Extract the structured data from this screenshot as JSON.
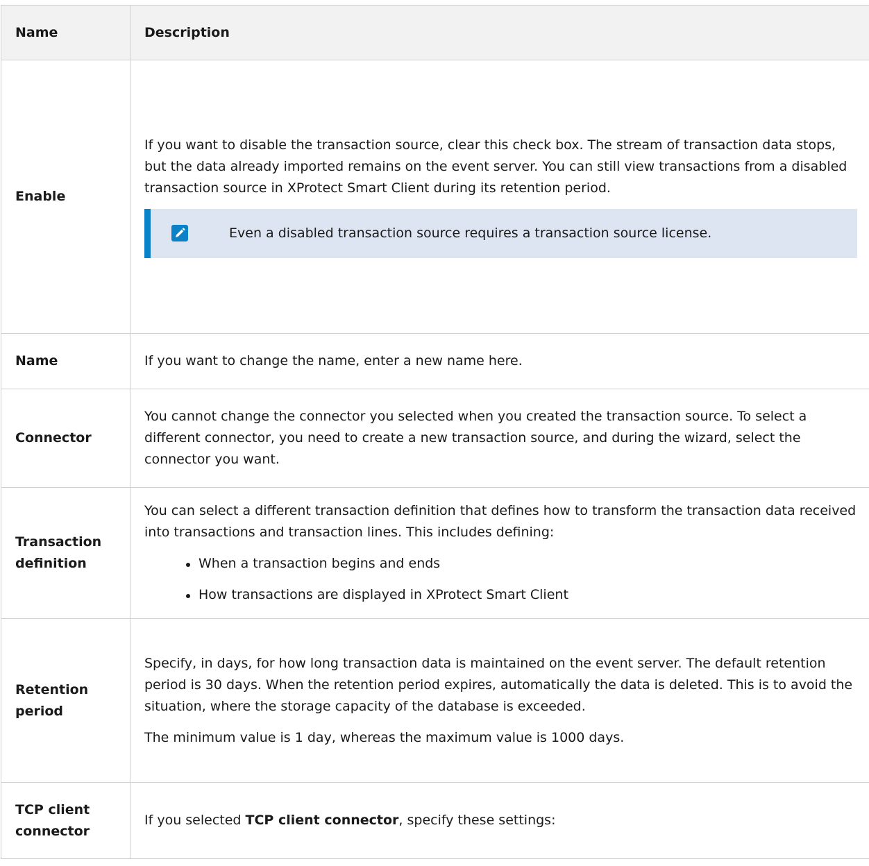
{
  "header": {
    "name": "Name",
    "description": "Description"
  },
  "rows": {
    "enable": {
      "name": "Enable",
      "text": "If you want to disable the transaction source, clear this check box. The stream of transaction data stops, but the data already imported remains on the event server. You can still view transactions from a disabled transaction source in XProtect Smart Client during its retention period.",
      "note": "Even a disabled transaction source requires a transaction source license.",
      "note_icon": "pencil-icon"
    },
    "name": {
      "name": "Name",
      "text": "If you want to change the name, enter a new name here."
    },
    "connector": {
      "name": "Connector",
      "text": "You cannot change the connector you selected when you created the transaction source. To select a different connector, you need to create a new transaction source, and during the wizard, select the connector you want."
    },
    "transaction_definition": {
      "name": "Transaction definition",
      "text": "You can select a different transaction definition that defines how to transform the transaction data received into transactions and transaction lines. This includes defining:",
      "bullets": [
        "When a transaction begins and ends",
        "How transactions are displayed in XProtect Smart Client"
      ]
    },
    "retention_period": {
      "name": "Retention period",
      "text": "Specify, in days, for how long transaction data is maintained on the event server. The default retention period is 30 days. When the retention period expires, automatically the data is deleted. This is to avoid the situation, where the storage capacity of the database is exceeded.",
      "text2": "The minimum value is 1 day, whereas the maximum value is 1000 days."
    },
    "tcp_client_connector": {
      "name": "TCP client connector",
      "text_before": "If you selected ",
      "text_bold": "TCP client connector",
      "text_after": ", specify these settings:"
    }
  },
  "colors": {
    "header_bg": "#f2f2f2",
    "border": "#cfcfcf",
    "note_bg": "#dde5f2",
    "note_accent": "#0b82c8"
  }
}
